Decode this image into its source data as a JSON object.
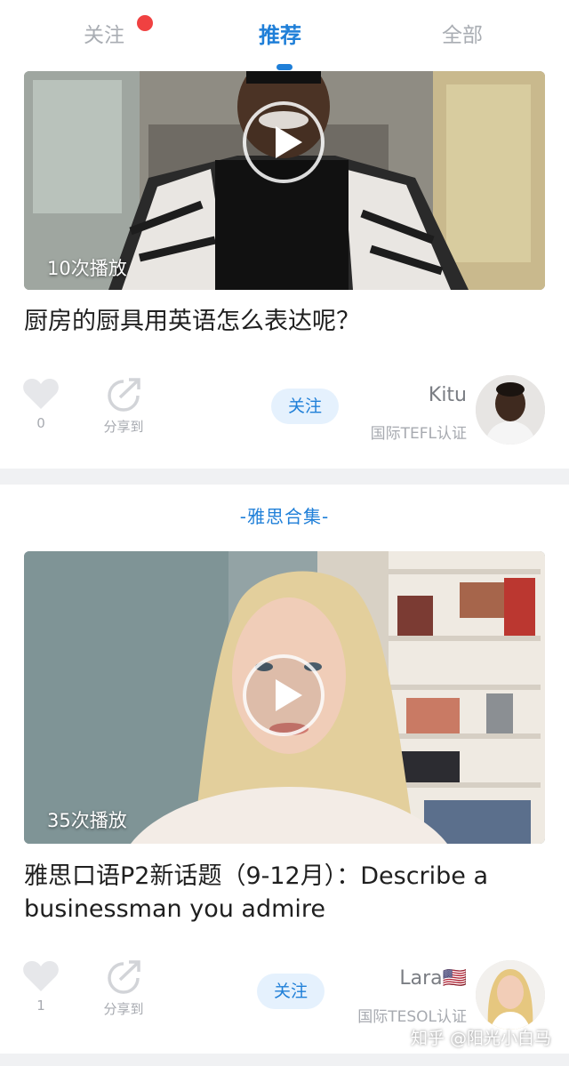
{
  "tabs": {
    "follow": "关注",
    "recommend": "推荐",
    "all": "全部"
  },
  "feed": [
    {
      "plays": "10次播放",
      "title": "厨房的厨具用英语怎么表达呢？",
      "likes": "0",
      "share_label": "分享到",
      "follow_label": "关注",
      "author_name": "Kitu",
      "author_cert": "国际TEFL认证"
    },
    {
      "collection": "-雅思合集-",
      "plays": "35次播放",
      "title": "雅思口语P2新话题（9-12月）：Describe a businessman you admire",
      "likes": "1",
      "share_label": "分享到",
      "follow_label": "关注",
      "author_name": "Lara🇺🇸",
      "author_cert": "国际TESOL认证"
    }
  ],
  "watermark": "知乎 @阳光小白马",
  "colors": {
    "accent": "#1f7fd8",
    "badge": "#f04141",
    "follow_bg": "#e5f1fd"
  }
}
